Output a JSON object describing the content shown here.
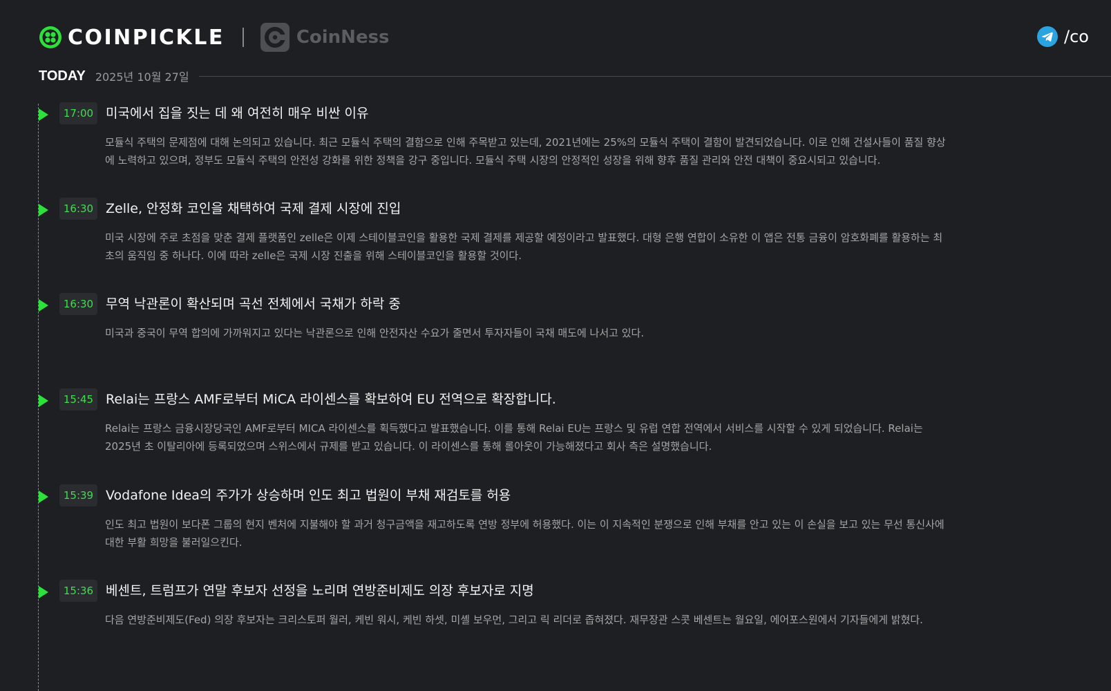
{
  "header": {
    "brand_primary": "COINPICKLE",
    "brand_secondary": "CoinNess",
    "telegram_text": "/co",
    "colors": {
      "accent_green": "#2ee03b",
      "background": "#1e1f22",
      "telegram_blue": "#2aa3e0"
    }
  },
  "today": {
    "label": "TODAY",
    "date": "2025년 10월 27일"
  },
  "news": [
    {
      "time": "17:00",
      "title": "미국에서 집을 짓는 데 왜 여전히 매우 비싼 이유",
      "body": "모듈식 주택의 문제점에 대해 논의되고 있습니다. 최근 모듈식 주택의 결함으로 인해 주목받고 있는데, 2021년에는 25%의 모듈식 주택이 결함이 발견되었습니다. 이로 인해 건설사들이 품질 향상에 노력하고 있으며, 정부도 모듈식 주택의 안전성 강화를 위한 정책을 강구 중입니다. 모듈식 주택 시장의 안정적인 성장을 위해 향후 품질 관리와 안전 대책이 중요시되고 있습니다."
    },
    {
      "time": "16:30",
      "title": "Zelle, 안정화 코인을 채택하여 국제 결제 시장에 진입",
      "body": "미국 시장에 주로 초점을 맞춘 결제 플랫폼인 zelle은 이제 스테이블코인을 활용한 국제 결제를 제공할 예정이라고 발표했다. 대형 은행 연합이 소유한 이 앱은 전통 금융이 암호화폐를 활용하는 최초의 움직임 중 하나다. 이에 따라 zelle은 국제 시장 진출을 위해 스테이블코인을 활용할 것이다."
    },
    {
      "time": "16:30",
      "title": "무역 낙관론이 확산되며 곡선 전체에서 국채가 하락 중",
      "body": "미국과 중국이 무역 합의에 가까워지고 있다는 낙관론으로 인해 안전자산 수요가 줄면서 투자자들이 국채 매도에 나서고 있다."
    },
    {
      "time": "15:45",
      "title": "Relai는 프랑스 AMF로부터 MiCA 라이센스를 확보하여 EU 전역으로 확장합니다.",
      "body": "Relai는 프랑스 금융시장당국인 AMF로부터 MICA 라이센스를 획득했다고 발표했습니다. 이를 통해 Relai EU는 프랑스 및 유럽 연합 전역에서 서비스를 시작할 수 있게 되었습니다. Relai는 2025년 초 이탈리아에 등록되었으며 스위스에서 규제를 받고 있습니다. 이 라이센스를 통해 롤아웃이 가능해졌다고 회사 측은 설명했습니다."
    },
    {
      "time": "15:39",
      "title": "Vodafone Idea의 주가가 상승하며 인도 최고 법원이 부채 재검토를 허용",
      "body": "인도 최고 법원이 보다폰 그룹의 현지 벤처에 지불해야 할 과거 청구금액을 재고하도록 연방 정부에 허용했다. 이는 이 지속적인 분쟁으로 인해 부채를 안고 있는 이 손실을 보고 있는 무선 통신사에 대한 부활 희망을 불러일으킨다."
    },
    {
      "time": "15:36",
      "title": "베센트, 트럼프가 연말 후보자 선정을 노리며 연방준비제도 의장 후보자로 지명",
      "body": "다음 연방준비제도(Fed) 의장 후보자는 크리스토퍼 월러, 케빈 워시, 케빈 하셋, 미셸 보우먼, 그리고 릭 리더로 좁혀졌다. 재무장관 스콧 베센트는 월요일, 에어포스원에서 기자들에게 밝혔다."
    }
  ]
}
